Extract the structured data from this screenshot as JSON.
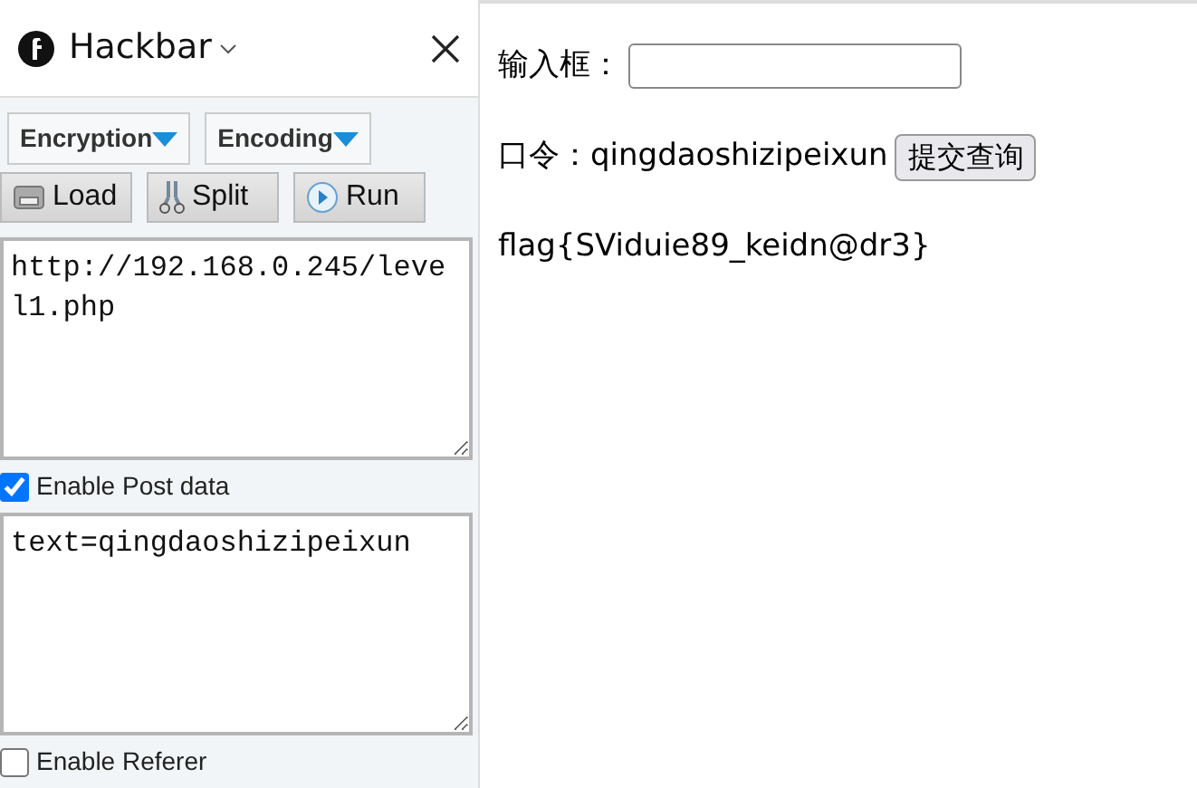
{
  "sidebar": {
    "title": "Hackbar",
    "menus": [
      {
        "label": "Encryption"
      },
      {
        "label": "Encoding"
      }
    ],
    "buttons": [
      {
        "label": "Load",
        "kind": "load"
      },
      {
        "label": "Split",
        "kind": "split"
      },
      {
        "label": "Run",
        "kind": "run"
      }
    ],
    "url_field": {
      "value": "http://192.168.0.245/level1.php"
    },
    "options": [
      {
        "label": "Enable Post data",
        "checked": true,
        "field": {
          "value": "text=qingdaoshizipeixun"
        }
      },
      {
        "label": "Enable Referer",
        "checked": false
      }
    ]
  },
  "page": {
    "input_label": "输入框：",
    "password_label": "口令：",
    "password_value": "qingdaoshizipeixun",
    "submit": "提交查询",
    "flag": "flag{SViduie89_keidn@dr3}"
  }
}
